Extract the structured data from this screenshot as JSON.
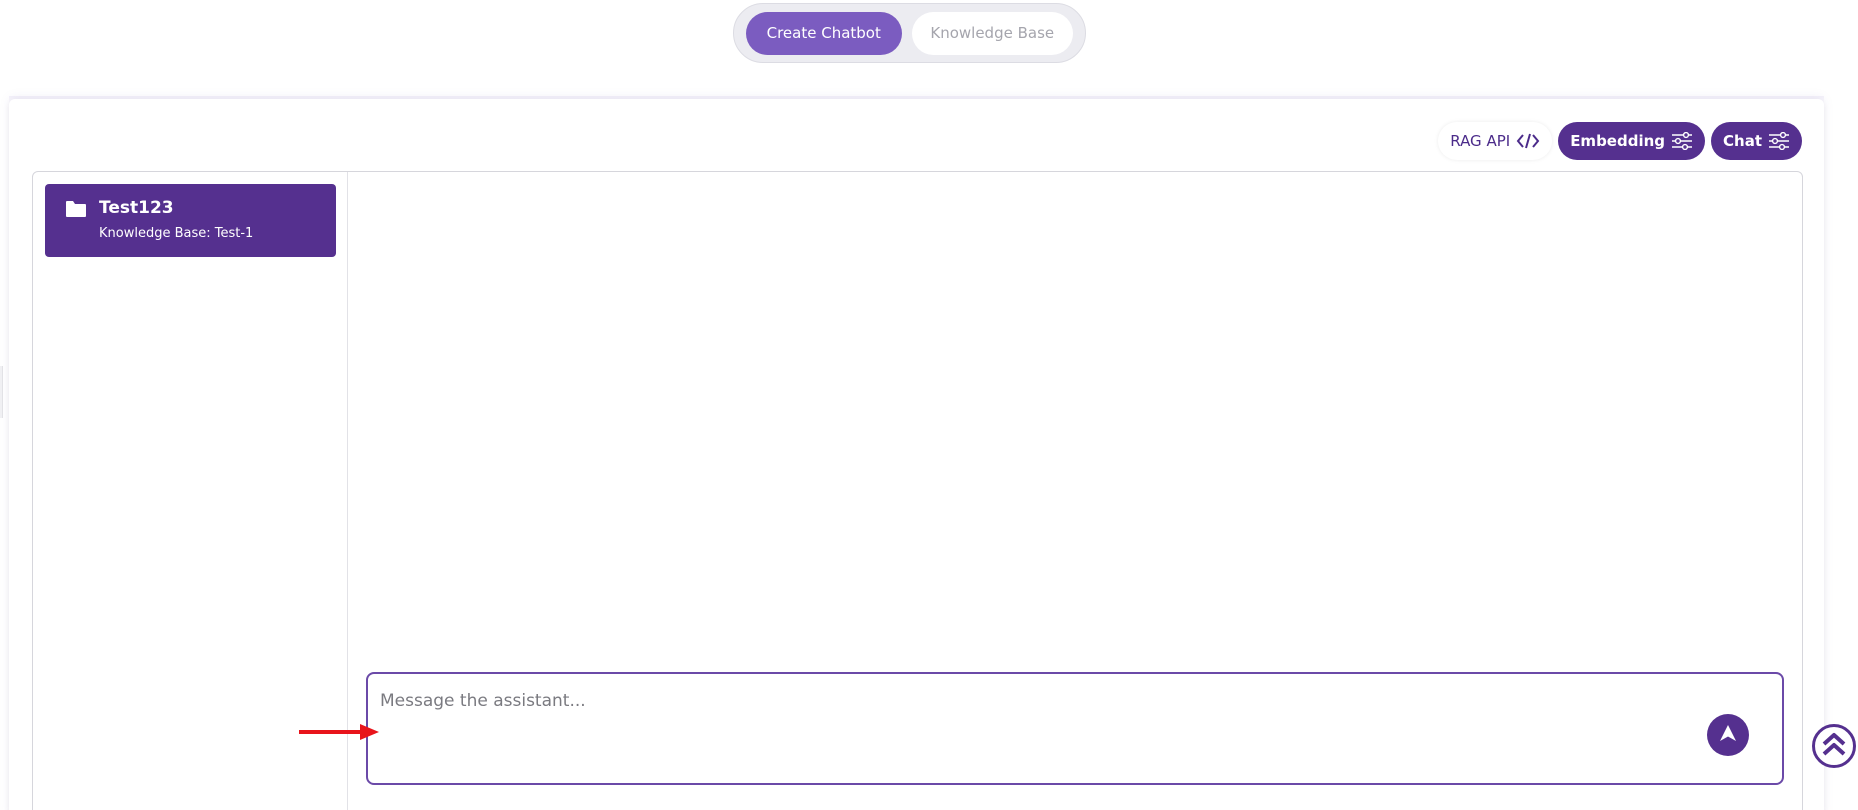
{
  "top_toggle": {
    "create_chatbot": "Create Chatbot",
    "knowledge_base": "Knowledge Base"
  },
  "actions": {
    "rag_api": "RAG API",
    "embedding": "Embedding",
    "chat": "Chat"
  },
  "sidebar": {
    "items": [
      {
        "title": "Test123",
        "subtitle": "Knowledge Base: Test-1"
      }
    ]
  },
  "chat": {
    "placeholder": "Message the assistant..."
  },
  "colors": {
    "accent": "#55308f",
    "accent_light": "#7b5cc0",
    "annotation": "#e8141b"
  },
  "icons": [
    "code-icon",
    "sliders-icon",
    "folder-icon",
    "send-arrow-icon",
    "double-chevron-up-icon"
  ]
}
